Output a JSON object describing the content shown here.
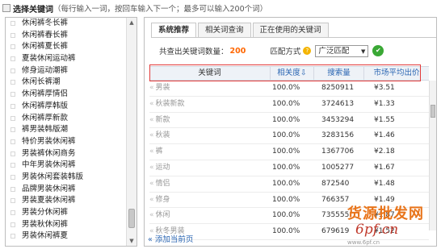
{
  "header": {
    "title": "选择关键词",
    "hint": "（每行输入一词，按回车输入下一个；最多可以输入200个词）"
  },
  "left_list": [
    "休闲裤冬长裤",
    "休闲裤春长裤",
    "休闲裤夏长裤",
    "夏装休闲运动裤",
    "修身运动潮裤",
    "休闲长裤潮",
    "休闲裤厚情侣",
    "休闲裤厚韩版",
    "休闲裤厚新款",
    "裤男装韩版潮",
    "特价男装休闲裤",
    "男装裤休闲商务",
    "中年男装休闲裤",
    "男装休闲套装韩版",
    "品牌男装休闲裤",
    "男装夏装休闲裤",
    "男装分休闲裤",
    "男装秋休闲裤",
    "男装休闲裤夏"
  ],
  "tabs": [
    "系统推荐",
    "相关词查询",
    "正在使用的关键词"
  ],
  "info": {
    "count_label": "共查出关键词数量：",
    "count_value": "200",
    "match_label": "匹配方式",
    "match_value": "广泛匹配"
  },
  "table": {
    "headers": [
      "关键词",
      "相关度",
      "搜索量",
      "市场平均出价"
    ],
    "rows": [
      {
        "keyword": "男装",
        "relevance": "100.0%",
        "searches": "8250911",
        "price": "¥3.51"
      },
      {
        "keyword": "秋装新款",
        "relevance": "100.0%",
        "searches": "3724613",
        "price": "¥1.33"
      },
      {
        "keyword": "新款",
        "relevance": "100.0%",
        "searches": "3453294",
        "price": "¥1.55"
      },
      {
        "keyword": "秋装",
        "relevance": "100.0%",
        "searches": "3283156",
        "price": "¥1.46"
      },
      {
        "keyword": "裤",
        "relevance": "100.0%",
        "searches": "1367706",
        "price": "¥2.18"
      },
      {
        "keyword": "运动",
        "relevance": "100.0%",
        "searches": "1005277",
        "price": "¥1.67"
      },
      {
        "keyword": "情侣",
        "relevance": "100.0%",
        "searches": "872540",
        "price": "¥1.48"
      },
      {
        "keyword": "修身",
        "relevance": "100.0%",
        "searches": "766357",
        "price": "¥1.49"
      },
      {
        "keyword": "休闲",
        "relevance": "100.0%",
        "searches": "735555",
        "price": "¥1.87"
      },
      {
        "keyword": "秋冬男装",
        "relevance": "100.0%",
        "searches": "679619",
        "price": "¥1.52"
      }
    ]
  },
  "add_link": "添加当前页",
  "watermark": {
    "title": "货源批发网",
    "url": "6pf.cn",
    "sub": "www.6pf.cn"
  }
}
